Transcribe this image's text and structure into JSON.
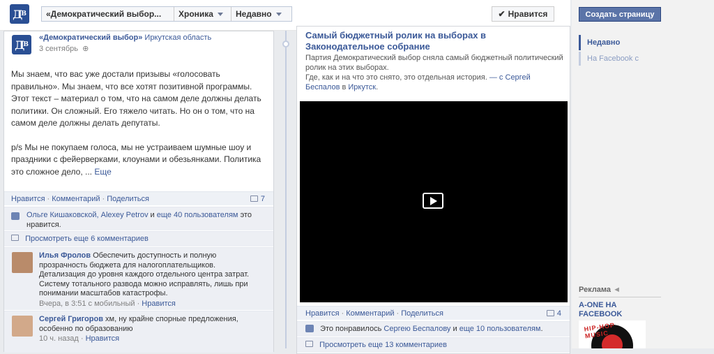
{
  "header": {
    "page_selector": "«Демократический выбор...",
    "timeline_menu": "Хроника",
    "recent_menu": "Недавно",
    "like_button": "Нравится"
  },
  "left_post": {
    "author": "«Демократический выбор»",
    "location": "Иркутская область",
    "date": "3 сентябрь",
    "paragraph1": "Мы знаем, что вас уже достали призывы «голосовать правильно». Мы знаем, что все хотят позитивной программы. Этот текст – материал о том, что на самом деле должны делать политики. Он сложный. Его тяжело читать. Но он о том, что на самом деле должны делать депутаты.",
    "paragraph2": "p/s Мы не покупаем голоса, мы не устраиваем шумные шоу и праздники с фейерверками, клоунами и обезьянками. Политика это сложное дело, ...",
    "more_link": "Еще",
    "actions": {
      "like": "Нравится",
      "comment": "Комментарий",
      "share": "Поделиться"
    },
    "comment_count": "7",
    "likes_names": "Ольге Кишаковской, Alexey Petrov",
    "likes_and": "и",
    "likes_others": "еще 40 пользователям",
    "likes_suffix": "это нравится.",
    "view_more_comments": "Просмотреть еще 6 комментариев",
    "comments": [
      {
        "author": "Илья Фролов",
        "text": "Обеспечить доступность и полную прозрачность бюджета для налогоплательщиков. Детализация до уровня каждого отдельного центра затрат. Систему тотального развода можно исправлять, лишь при понимании масштабов катастрофы.",
        "meta": "Вчера, в 3:51 с мобильный",
        "like": "Нравится"
      },
      {
        "author": "Сергей Григоров",
        "text": "хм, ну крайне спорные предложения, особенно по образованию",
        "meta": "10 ч. назад",
        "like": "Нравится"
      }
    ]
  },
  "right_post": {
    "title": "Самый бюджетный ролик на выборах в Законодательное собрание",
    "desc_line": "Партия Демократический выбор сняла самый бюджетный политический ролик на этих выборах.",
    "desc_line2": "Где, как и на что это снято, это отдельная история.",
    "with_prefix": "— с",
    "with_person": "Сергей Беспалов",
    "in_word": "в",
    "place": "Иркутск",
    "actions": {
      "like": "Нравится",
      "comment": "Комментарий",
      "share": "Поделиться"
    },
    "comment_count": "4",
    "likes_prefix": "Это понравилось",
    "likes_person": "Сергею Беспалову",
    "likes_and": "и",
    "likes_others": "еще 10 пользователям",
    "view_more_comments": "Просмотреть еще 13 комментариев"
  },
  "sidebar": {
    "create_page": "Создать страницу",
    "nav_recent": "Недавно",
    "nav_facebook": "На Facebook с",
    "ads_title": "Реклама",
    "ad_title": "A-ONE НА FACEBOOK",
    "ad_image_text": "HIP-HOP MUSIC"
  },
  "colors": {
    "link": "#3b5998",
    "brand_blue": "#2a4f94",
    "button_blue": "#5b74a8"
  },
  "icons": [
    "logo-icon",
    "globe-icon",
    "comment-icon",
    "thumb-up-icon",
    "play-icon",
    "chevron-down-icon",
    "checkmark-icon",
    "ad-icon"
  ]
}
